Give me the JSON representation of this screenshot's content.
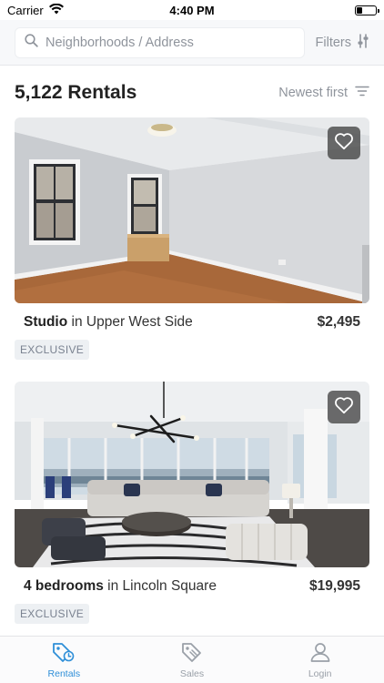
{
  "status_bar": {
    "carrier": "Carrier",
    "time": "4:40 PM",
    "battery_level": 0.3
  },
  "search": {
    "placeholder": "Neighborhoods / Address",
    "value": "",
    "filters_label": "Filters"
  },
  "results": {
    "count_label": "5,122 Rentals",
    "sort_label": "Newest first"
  },
  "listings": [
    {
      "beds": "Studio",
      "location_text": " in Upper West Side",
      "price": "$2,495",
      "badge": "EXCLUSIVE",
      "favorited": false
    },
    {
      "beds": "4 bedrooms",
      "location_text": " in Lincoln Square",
      "price": "$19,995",
      "badge": "EXCLUSIVE",
      "favorited": false
    }
  ],
  "tabs": [
    {
      "label": "Rentals",
      "icon": "rentals-tag-icon",
      "active": true
    },
    {
      "label": "Sales",
      "icon": "sales-tag-icon",
      "active": false
    },
    {
      "label": "Login",
      "icon": "user-icon",
      "active": false
    }
  ],
  "colors": {
    "accent": "#2f8fd8",
    "muted_text": "#8f949c",
    "badge_bg": "#edf0f3"
  }
}
